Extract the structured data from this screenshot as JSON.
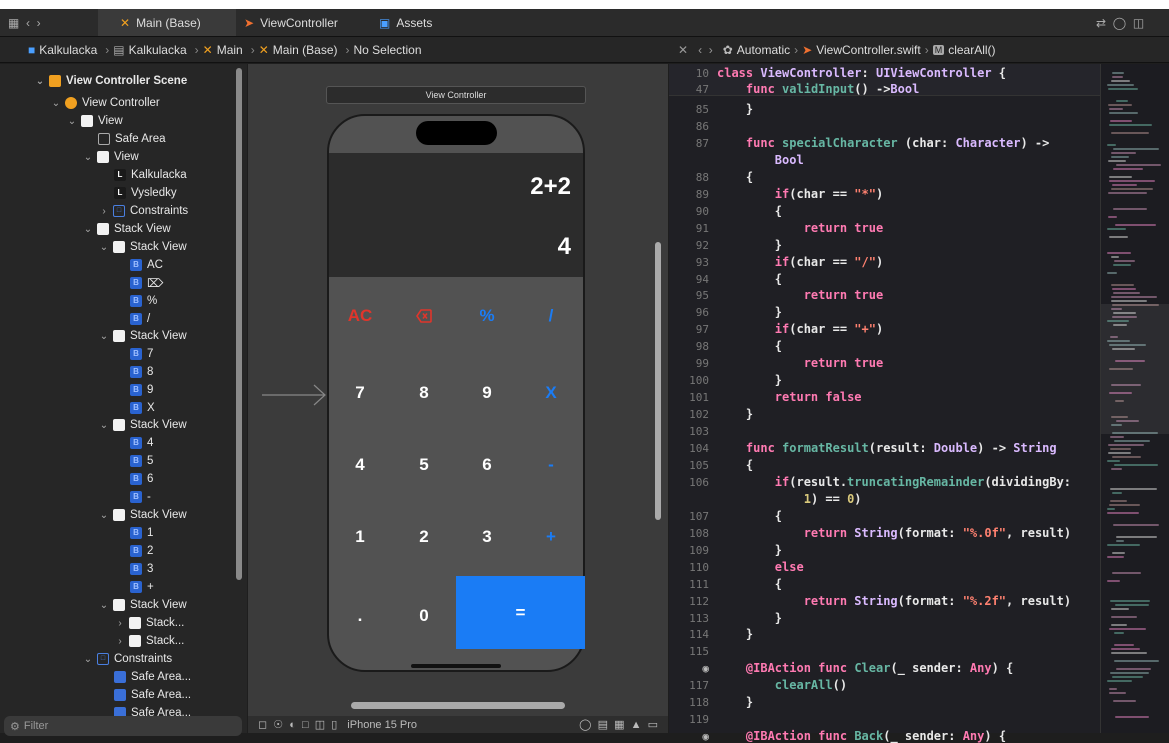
{
  "tabs": [
    {
      "label": "Main (Base)",
      "active": true
    },
    {
      "label": "ViewController",
      "active": false
    },
    {
      "label": "Assets",
      "active": false
    }
  ],
  "breadcrumb": [
    "Kalkulacka",
    "Kalkulacka",
    "Main",
    "Main (Base)",
    "No Selection"
  ],
  "editor_crumb": [
    "Automatic",
    "ViewController.swift",
    "clearAll()"
  ],
  "outline": {
    "scene": "View Controller Scene",
    "vc": "View Controller",
    "view": "View",
    "safe_area": "Safe Area",
    "inner_view": "View",
    "label1": "Kalkulacka",
    "label2": "Vysledky",
    "constraints": "Constraints",
    "stack_view": "Stack View",
    "stack1": "Stack View",
    "s1": [
      "AC",
      "⌦",
      "%",
      "/"
    ],
    "stack2": "Stack View",
    "s2": [
      "7",
      "8",
      "9",
      "X"
    ],
    "stack3": "Stack View",
    "s3": [
      "4",
      "5",
      "6",
      "-"
    ],
    "stack4": "Stack View",
    "s4": [
      "1",
      "2",
      "3",
      "+"
    ],
    "stack5": "Stack View",
    "s5": [
      "Stack...",
      "Stack..."
    ],
    "constraints2": "Constraints",
    "sa": [
      "Safe Area...",
      "Safe Area...",
      "Safe Area..."
    ],
    "filter_placeholder": "Filter"
  },
  "canvas": {
    "vc_title": "View Controller",
    "expression": "2+2",
    "result": "4",
    "keys": [
      [
        "AC",
        "⌦",
        "%",
        "/"
      ],
      [
        "7",
        "8",
        "9",
        "X"
      ],
      [
        "4",
        "5",
        "6",
        "-"
      ],
      [
        "1",
        "2",
        "3",
        "+"
      ],
      [
        ".",
        "0",
        "="
      ]
    ],
    "device": "iPhone 15 Pro"
  },
  "code": {
    "sticky_ln": [
      "10",
      "47"
    ],
    "line_numbers": [
      "85",
      "86",
      "87",
      "",
      "88",
      "89",
      "90",
      "91",
      "92",
      "93",
      "94",
      "95",
      "96",
      "97",
      "98",
      "99",
      "100",
      "101",
      "102",
      "103",
      "104",
      "105",
      "106",
      "",
      "107",
      "108",
      "109",
      "110",
      "111",
      "112",
      "113",
      "114",
      "115",
      "",
      "117",
      "118",
      "119",
      ""
    ]
  },
  "colors": {
    "accent": "#1a7cf5",
    "red": "#e0352b"
  }
}
